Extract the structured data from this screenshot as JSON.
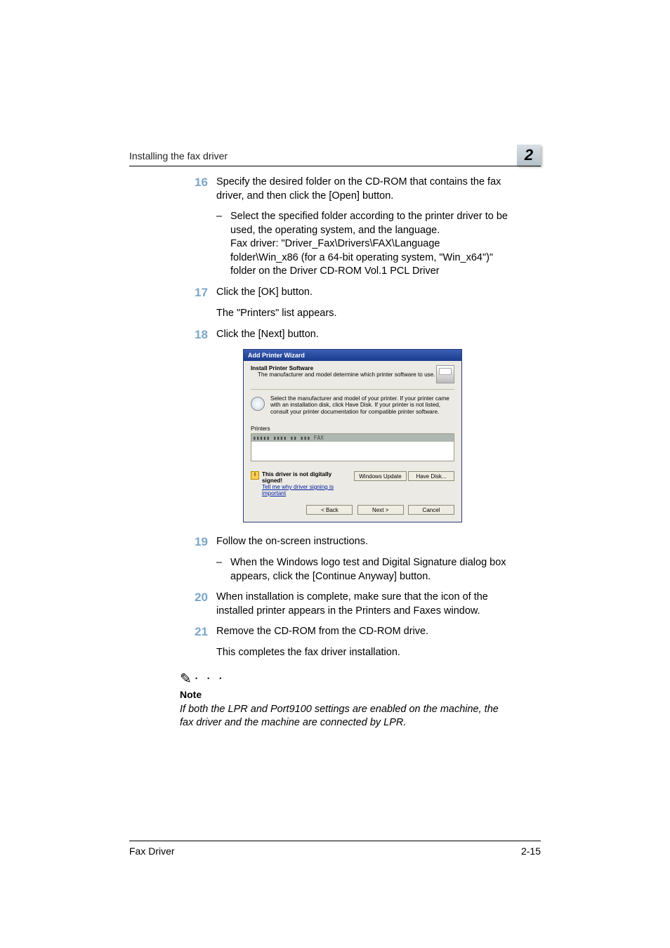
{
  "header": {
    "title": "Installing the fax driver",
    "chapter": "2"
  },
  "steps": {
    "s16": {
      "num": "16",
      "text": "Specify the desired folder on the CD-ROM that contains the fax driver, and then click the [Open] button.",
      "sub_dash": "–",
      "sub_text": "Select the specified folder according to the printer driver to be used, the operating system, and the language.\nFax driver: \"Driver_Fax\\Drivers\\FAX\\Language folder\\Win_x86 (for a 64-bit operating system, \"Win_x64\")\" folder on the Driver CD-ROM Vol.1 PCL Driver"
    },
    "s17": {
      "num": "17",
      "text": "Click the [OK] button.",
      "after": "The \"Printers\" list appears."
    },
    "s18": {
      "num": "18",
      "text": "Click the [Next] button."
    },
    "s19": {
      "num": "19",
      "text": "Follow the on-screen instructions.",
      "sub_dash": "–",
      "sub_text": "When the Windows logo test and Digital Signature dialog box appears, click the [Continue Anyway] button."
    },
    "s20": {
      "num": "20",
      "text": "When installation is complete, make sure that the icon of the installed printer appears in the Printers and Faxes window."
    },
    "s21": {
      "num": "21",
      "text": "Remove the CD-ROM from the CD-ROM drive.",
      "after": "This completes the fax driver installation."
    }
  },
  "note": {
    "icon_dots": ". . .",
    "title": "Note",
    "body": "If both the LPR and Port9100 settings are enabled on the machine, the fax driver and the machine are connected by LPR."
  },
  "dialog": {
    "title": "Add Printer Wizard",
    "heading": "Install Printer Software",
    "subheading": "The manufacturer and model determine which printer software to use.",
    "desc": "Select the manufacturer and model of your printer. If your printer came with an installation disk, click Have Disk. If your printer is not listed, consult your printer documentation for compatible printer software.",
    "printers_label": "Printers",
    "printers_selected": "▮▮▮▮▮ ▮▮▮▮ ▮▮ ▮▮▮ FAX",
    "warn_line1": "This driver is not digitally signed!",
    "warn_link": "Tell me why driver signing is important",
    "btn_windows_update": "Windows Update",
    "btn_have_disk": "Have Disk...",
    "btn_back": "< Back",
    "btn_next": "Next >",
    "btn_cancel": "Cancel"
  },
  "footer": {
    "left": "Fax Driver",
    "right": "2-15"
  }
}
